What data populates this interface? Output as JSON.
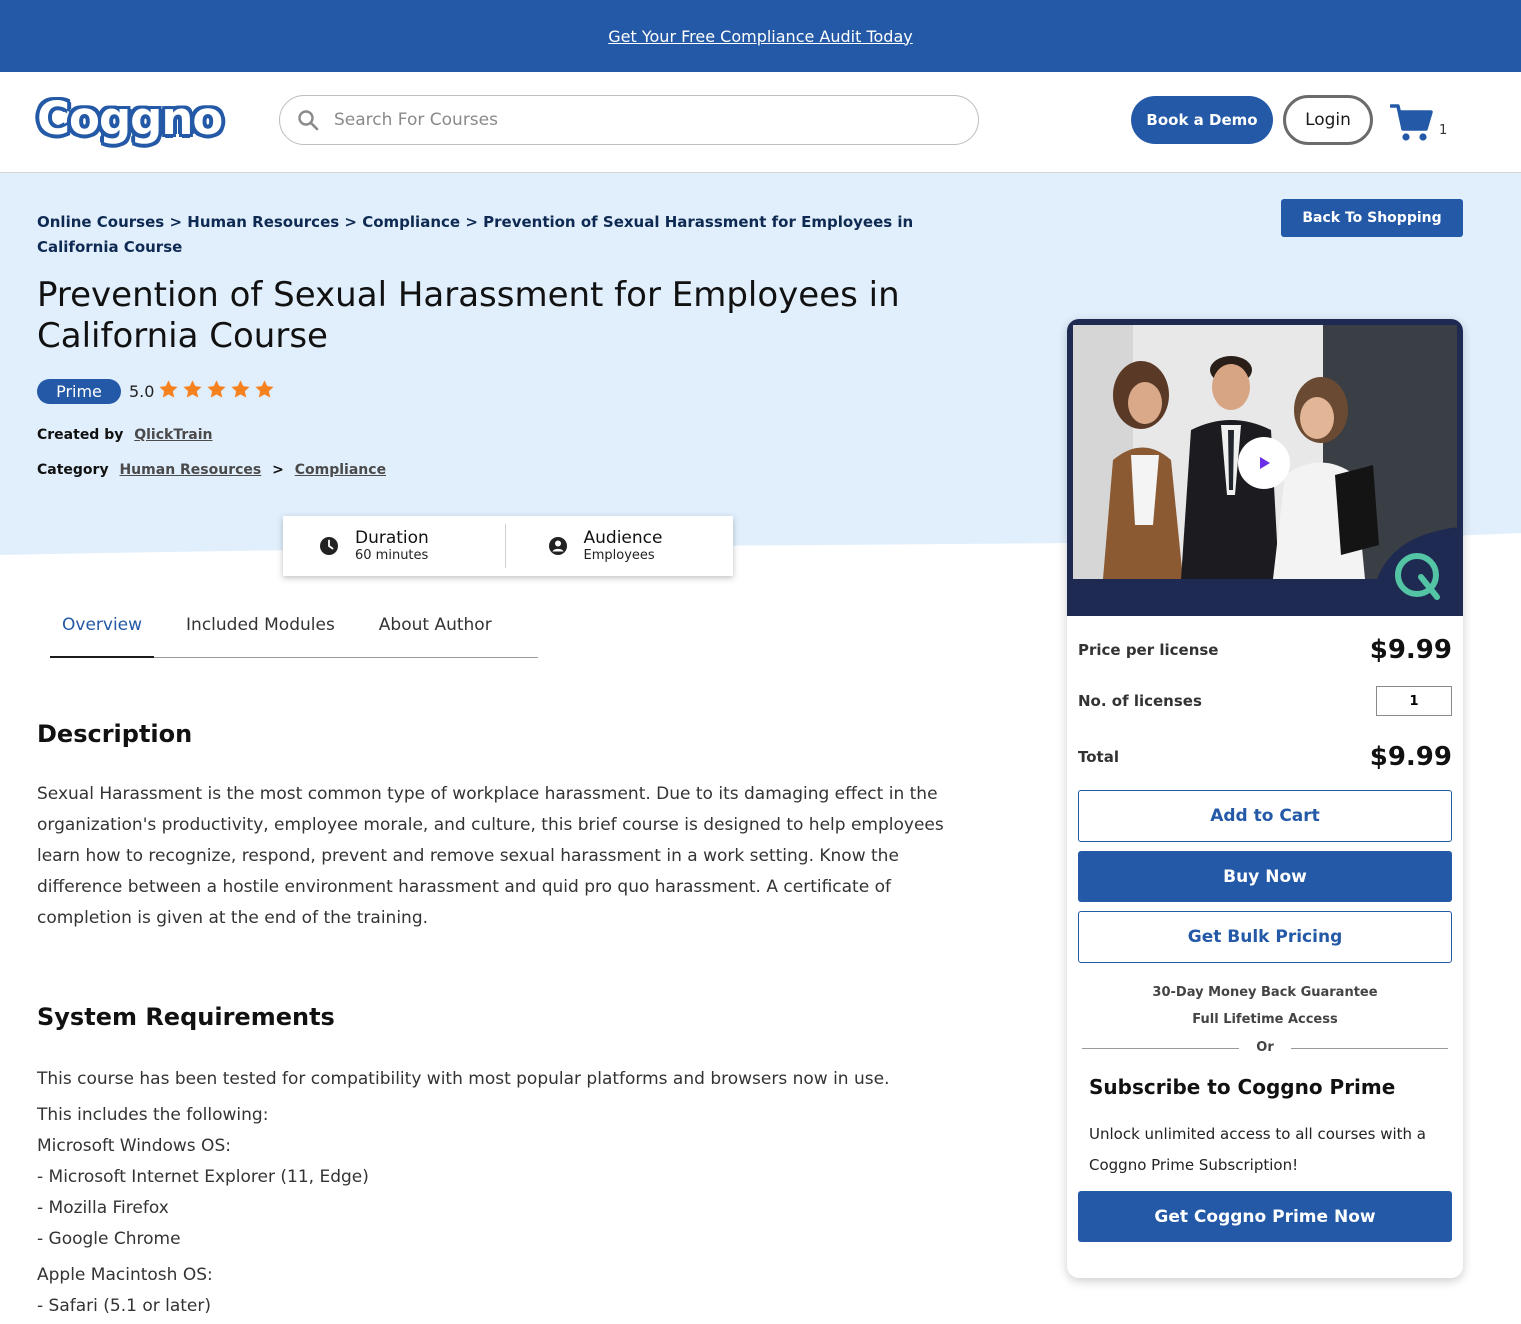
{
  "promo_bar": {
    "link_text": "Get Your Free Compliance Audit Today"
  },
  "header": {
    "logo_text": "Coggno",
    "search_placeholder": "Search For Courses",
    "book_demo_label": "Book a Demo",
    "login_label": "Login",
    "cart_count": "1"
  },
  "breadcrumb": {
    "items": [
      "Online Courses",
      "Human Resources",
      "Compliance",
      "Prevention of Sexual Harassment for Employees in California Course"
    ],
    "separator": ">"
  },
  "back_button_label": "Back To Shopping",
  "course": {
    "title": "Prevention of Sexual Harassment for Employees in California Course",
    "badge": "Prime",
    "rating": "5.0",
    "stars": 5,
    "created_by_label": "Created by",
    "author": "QlickTrain",
    "category_label": "Category",
    "category": "Human Resources",
    "subcategory": "Compliance",
    "category_separator": ">"
  },
  "info": {
    "duration_label": "Duration",
    "duration_value": "60 minutes",
    "audience_label": "Audience",
    "audience_value": "Employees"
  },
  "tabs": [
    {
      "label": "Overview",
      "active": true
    },
    {
      "label": "Included Modules",
      "active": false
    },
    {
      "label": "About Author",
      "active": false
    }
  ],
  "description": {
    "heading": "Description",
    "text": "Sexual Harassment is the most common type of workplace harassment. Due to its damaging effect in the organization's productivity, employee morale, and culture, this brief course is designed to help employees learn how to recognize, respond, prevent and remove sexual harassment in a work setting. Know the difference between a hostile environment harassment and quid pro quo harassment. A certificate of completion is given at the end of the training."
  },
  "system_requirements": {
    "heading": "System Requirements",
    "lines": [
      "This course has been tested for compatibility with most popular platforms and browsers now in use.",
      "This includes the following:",
      "Microsoft Windows OS:",
      "- Microsoft Internet Explorer (11, Edge)",
      "- Mozilla Firefox",
      "- Google Chrome",
      "Apple Macintosh OS:",
      "- Safari (5.1 or later)"
    ]
  },
  "purchase": {
    "price_label": "Price per license",
    "price": "$9.99",
    "licenses_label": "No. of licenses",
    "licenses_value": "1",
    "total_label": "Total",
    "total": "$9.99",
    "add_to_cart_label": "Add to Cart",
    "buy_now_label": "Buy Now",
    "bulk_label": "Get Bulk Pricing",
    "guarantee": "30-Day Money Back Guarantee",
    "lifetime": "Full Lifetime Access",
    "or_text": "Or",
    "subscribe_title": "Subscribe to Coggno Prime",
    "subscribe_text": "Unlock unlimited access to all courses with a Coggno Prime Subscription!",
    "prime_button_label": "Get Coggno Prime Now"
  },
  "colors": {
    "brand_blue": "#2359a6",
    "hero_bg": "#e1effd",
    "star": "#f5821f",
    "video_bg": "#1f2a52"
  }
}
